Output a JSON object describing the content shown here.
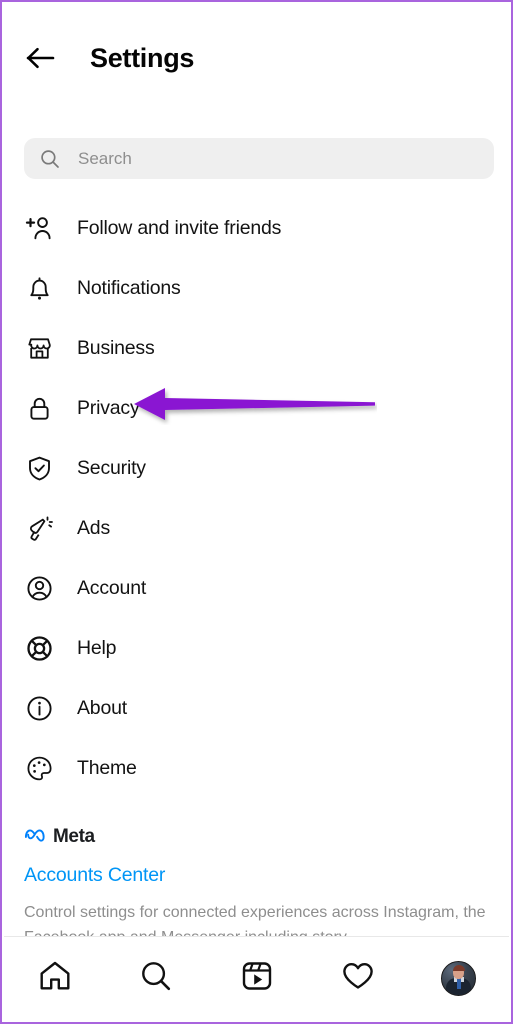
{
  "window": {
    "border_color": "#a964de"
  },
  "header": {
    "back_icon": "arrow-left-icon",
    "title": "Settings"
  },
  "search": {
    "icon": "search-icon",
    "placeholder": "Search",
    "value": ""
  },
  "settings_list": {
    "items": [
      {
        "icon": "person-add-icon",
        "label": "Follow and invite friends"
      },
      {
        "icon": "bell-icon",
        "label": "Notifications"
      },
      {
        "icon": "storefront-icon",
        "label": "Business"
      },
      {
        "icon": "lock-icon",
        "label": "Privacy"
      },
      {
        "icon": "shield-check-icon",
        "label": "Security"
      },
      {
        "icon": "megaphone-icon",
        "label": "Ads"
      },
      {
        "icon": "user-circle-icon",
        "label": "Account"
      },
      {
        "icon": "lifebuoy-icon",
        "label": "Help"
      },
      {
        "icon": "info-circle-icon",
        "label": "About"
      },
      {
        "icon": "palette-icon",
        "label": "Theme"
      }
    ]
  },
  "meta_section": {
    "logo_icon": "meta-infinity-icon",
    "logo_color": "#0081fb",
    "brand": "Meta",
    "accounts_center_link": "Accounts Center",
    "accounts_center_color": "#0095f6",
    "description": "Control settings for connected experiences across Instagram, the Facebook app and Messenger including story..."
  },
  "annotation": {
    "type": "arrow",
    "direction": "left",
    "color": "#8a19d2",
    "points_at": "Privacy"
  },
  "bottom_nav": {
    "items": [
      {
        "icon": "home-icon",
        "label": "Home"
      },
      {
        "icon": "search-icon",
        "label": "Search"
      },
      {
        "icon": "reels-icon",
        "label": "Reels"
      },
      {
        "icon": "heart-icon",
        "label": "Activity"
      },
      {
        "icon": "profile-avatar",
        "label": "Profile"
      }
    ]
  }
}
